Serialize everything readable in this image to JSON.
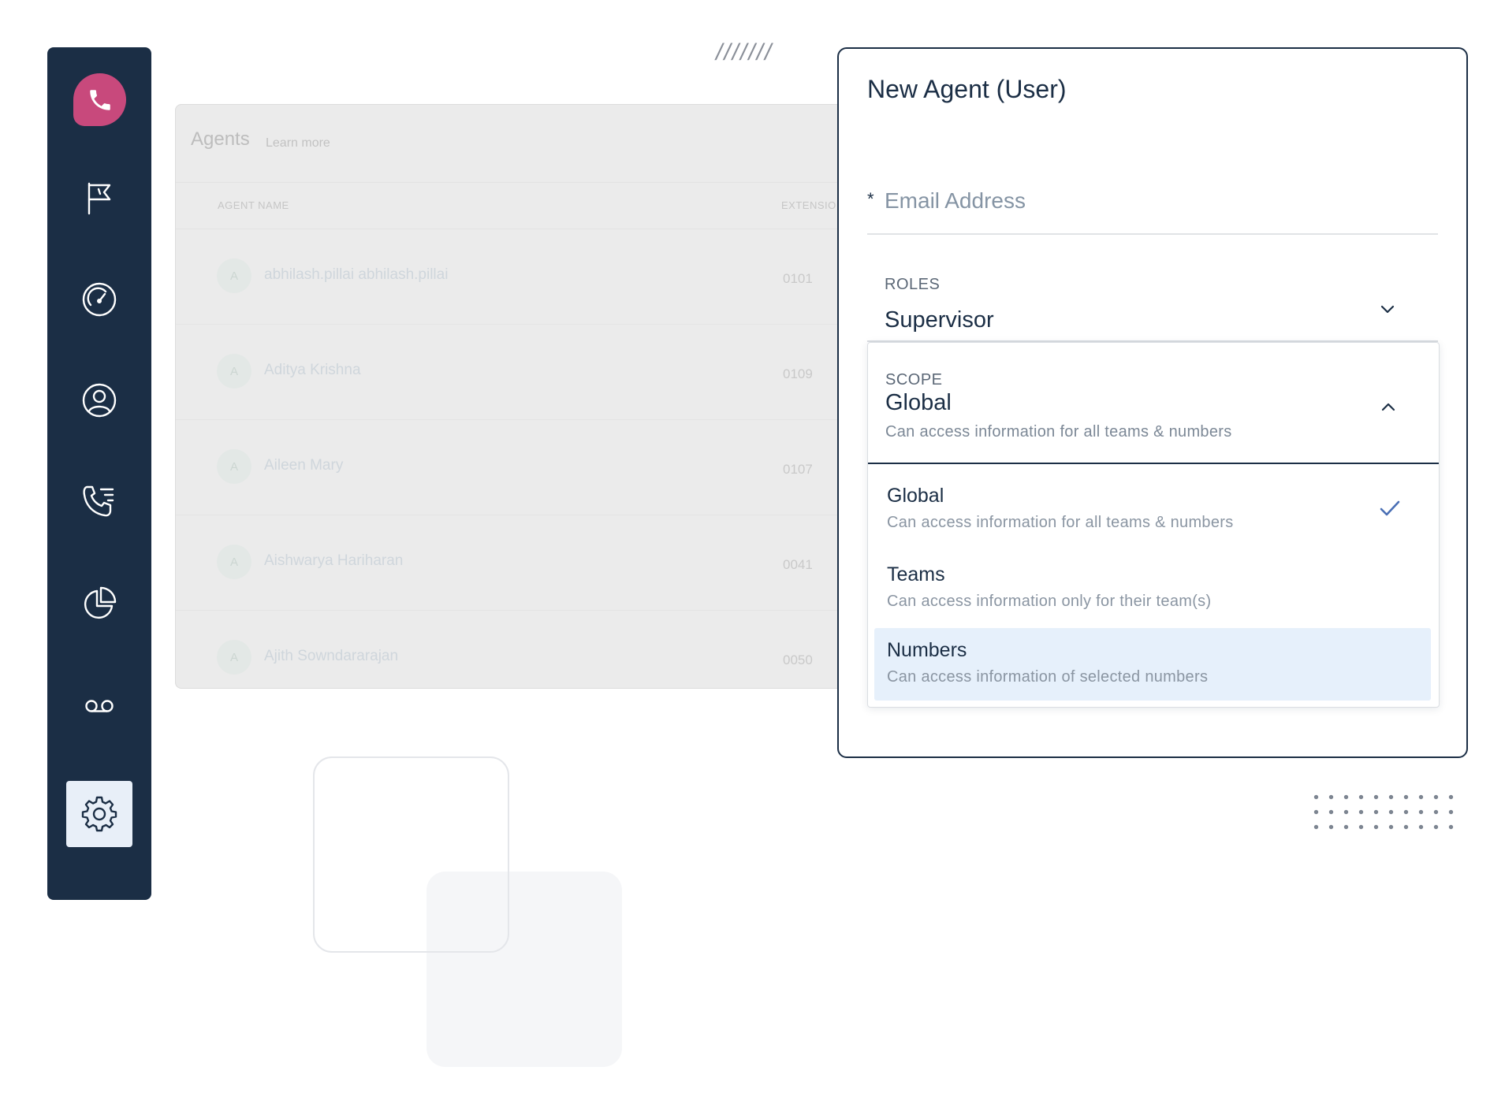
{
  "sidebar": {
    "items": [
      {
        "icon": "phone-icon"
      },
      {
        "icon": "flag-icon"
      },
      {
        "icon": "speedometer-icon"
      },
      {
        "icon": "user-circle-icon"
      },
      {
        "icon": "call-list-icon"
      },
      {
        "icon": "pie-chart-icon"
      },
      {
        "icon": "voicemail-icon"
      },
      {
        "icon": "gear-icon",
        "active": true
      }
    ]
  },
  "agents": {
    "title": "Agents",
    "learn_more": "Learn more",
    "columns": {
      "name": "AGENT NAME",
      "extension": "EXTENSIO"
    },
    "rows": [
      {
        "initial": "A",
        "name": "abhilash.pillai abhilash.pillai",
        "ext": "0101"
      },
      {
        "initial": "A",
        "name": "Aditya Krishna",
        "ext": "0109"
      },
      {
        "initial": "A",
        "name": "Aileen Mary",
        "ext": "0107"
      },
      {
        "initial": "A",
        "name": "Aishwarya Hariharan",
        "ext": "0041"
      },
      {
        "initial": "A",
        "name": "Ajith Sowndararajan",
        "ext": "0050"
      }
    ]
  },
  "decoration": {
    "slashes": "///////"
  },
  "panel": {
    "title": "New Agent (User)",
    "email": {
      "required_mark": "*",
      "placeholder": "Email Address",
      "value": ""
    },
    "roles": {
      "label": "ROLES",
      "value": "Supervisor"
    },
    "scope": {
      "label": "SCOPE",
      "value": "Global",
      "description": "Can access information for all teams & numbers",
      "options": [
        {
          "label": "Global",
          "description": "Can access information for all teams & numbers",
          "selected": true
        },
        {
          "label": "Teams",
          "description": "Can access information only for their team(s)",
          "selected": false
        },
        {
          "label": "Numbers",
          "description": "Can access information of selected numbers",
          "highlighted": true
        }
      ]
    }
  },
  "colors": {
    "sidebar_bg": "#1b2e45",
    "brand_pink": "#c8497c",
    "check_blue": "#4a6fb5",
    "highlight": "#e6f0fb"
  }
}
